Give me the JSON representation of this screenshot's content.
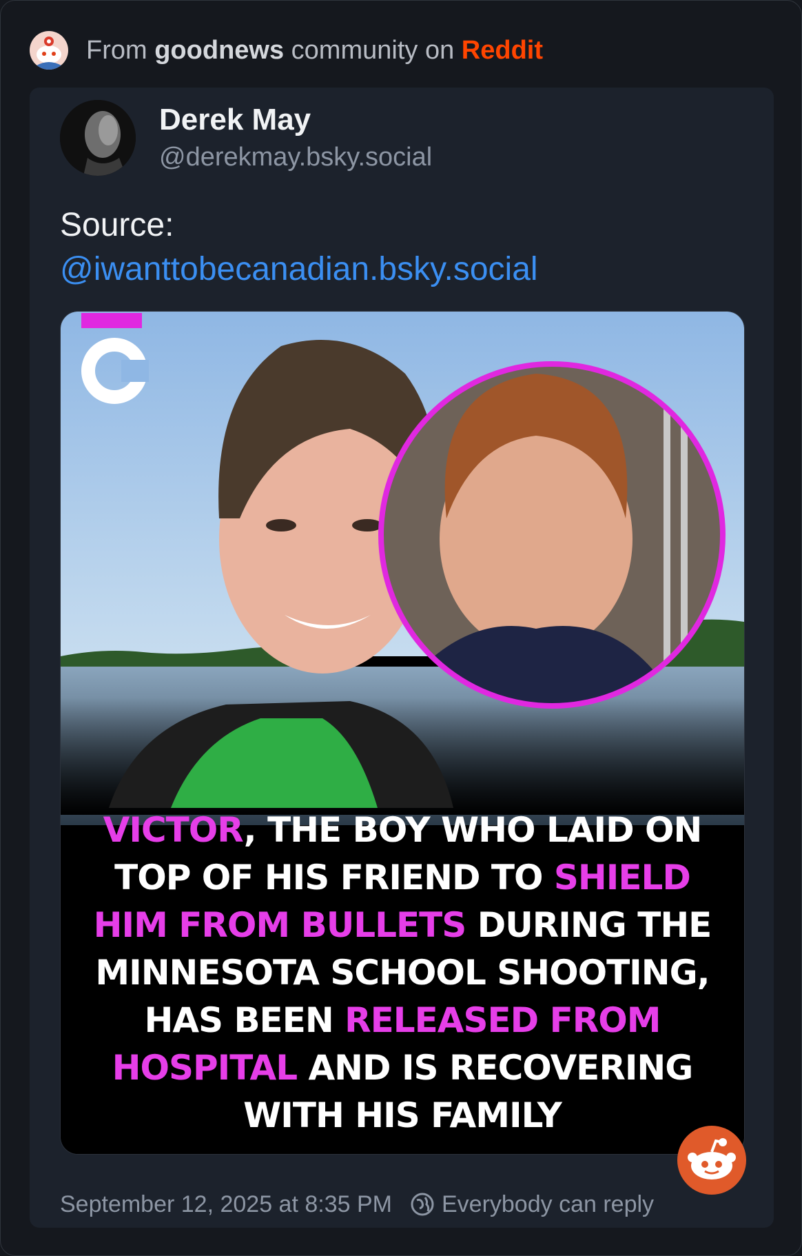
{
  "source": {
    "prefix": "From",
    "community": "goodnews",
    "middle": "community on",
    "platform": "Reddit"
  },
  "post": {
    "author_name": "Derek May",
    "author_handle": "@derekmay.bsky.social",
    "text_label": "Source:",
    "text_link": "@iwanttobecanadian.bsky.social",
    "timestamp": "September 12, 2025 at 8:35 PM",
    "reply_setting": "Everybody can reply"
  },
  "media": {
    "logo_letter": "C",
    "caption": {
      "l1_hl": "VICTOR",
      "l1": ", THE BOY WHO LAID ON",
      "l2": "TOP OF HIS FRIEND TO ",
      "l2_hl": "SHIELD",
      "l3_hl": "HIM FROM BULLETS",
      "l3": " DURING THE",
      "l4": "MINNESOTA SCHOOL SHOOTING,",
      "l5": "HAS BEEN ",
      "l5_hl": "RELEASED FROM",
      "l6_hl": "HOSPITAL",
      "l6": " AND IS RECOVERING",
      "l7": "WITH HIS FAMILY"
    }
  },
  "colors": {
    "background": "#15181e",
    "card": "#1c222c",
    "reddit_orange": "#ff4500",
    "link_blue": "#3b8ff2",
    "highlight_magenta": "#e63ee8"
  },
  "icons": {
    "source_icon": "reddit-snoo-icon",
    "reply_icon": "globe-icon",
    "badge": "reddit-snoo-badge"
  }
}
